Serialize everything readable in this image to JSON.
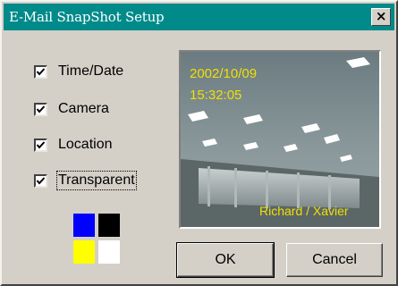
{
  "window": {
    "title": "E-Mail SnapShot Setup",
    "close_label": "×"
  },
  "options": [
    {
      "label": "Time/Date",
      "checked": true
    },
    {
      "label": "Camera",
      "checked": true
    },
    {
      "label": "Location",
      "checked": true
    },
    {
      "label": "Transparent",
      "checked": true
    }
  ],
  "swatches": [
    "#0000ff",
    "#000000",
    "#ffff00",
    "#ffffff"
  ],
  "preview": {
    "date": "2002/10/09",
    "time": "15:32:05",
    "caption": "Richard / Xavier",
    "overlay_color": "#f0e000"
  },
  "buttons": {
    "ok_label": "OK",
    "cancel_label": "Cancel"
  }
}
